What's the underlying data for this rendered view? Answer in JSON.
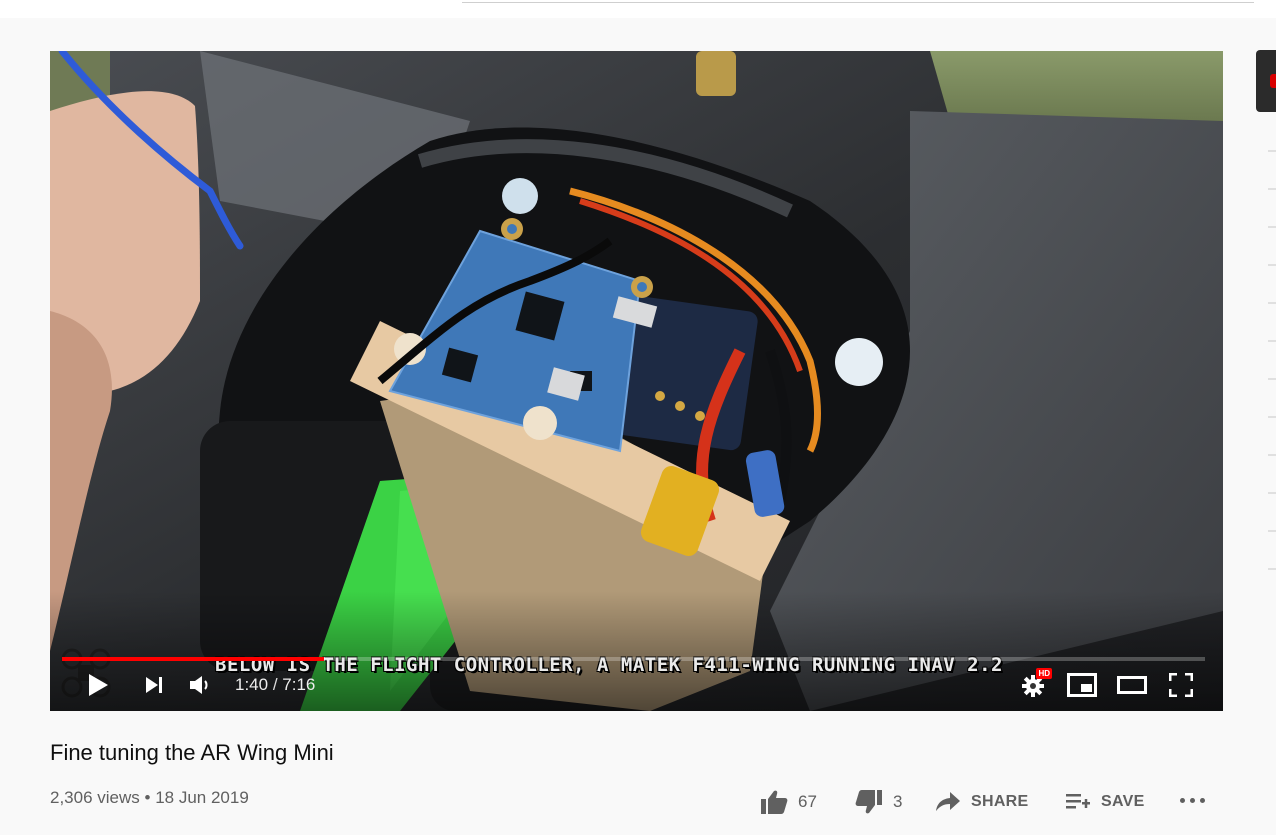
{
  "video": {
    "title": "Fine tuning the AR Wing Mini",
    "views": "2,306 views",
    "meta_sep": "•",
    "date": "18 Jun 2019",
    "caption": "BELOW IS THE FLIGHT CONTROLLER, A MATEK F411-WING RUNNING INAV 2.2",
    "subject_icons": [
      "flight-controller-board",
      "drone-logo-watermark"
    ]
  },
  "player": {
    "current_time": "1:40",
    "time_sep": "/",
    "duration": "7:16",
    "progress_played": 0.229,
    "progress_loaded": 0.23,
    "hd_badge": "HD",
    "accent_color": "#ff0000",
    "icons": {
      "play": "play-icon",
      "next": "next-icon",
      "volume": "volume-icon",
      "settings": "gear-icon",
      "miniplayer": "miniplayer-icon",
      "theater": "theater-icon",
      "fullscreen": "fullscreen-icon"
    }
  },
  "actions": {
    "like_count": "67",
    "dislike_count": "3",
    "share_label": "SHARE",
    "save_label": "SAVE",
    "icons": [
      "thumbs-up-icon",
      "thumbs-down-icon",
      "share-icon",
      "save-playlist-icon",
      "more-icon"
    ]
  }
}
